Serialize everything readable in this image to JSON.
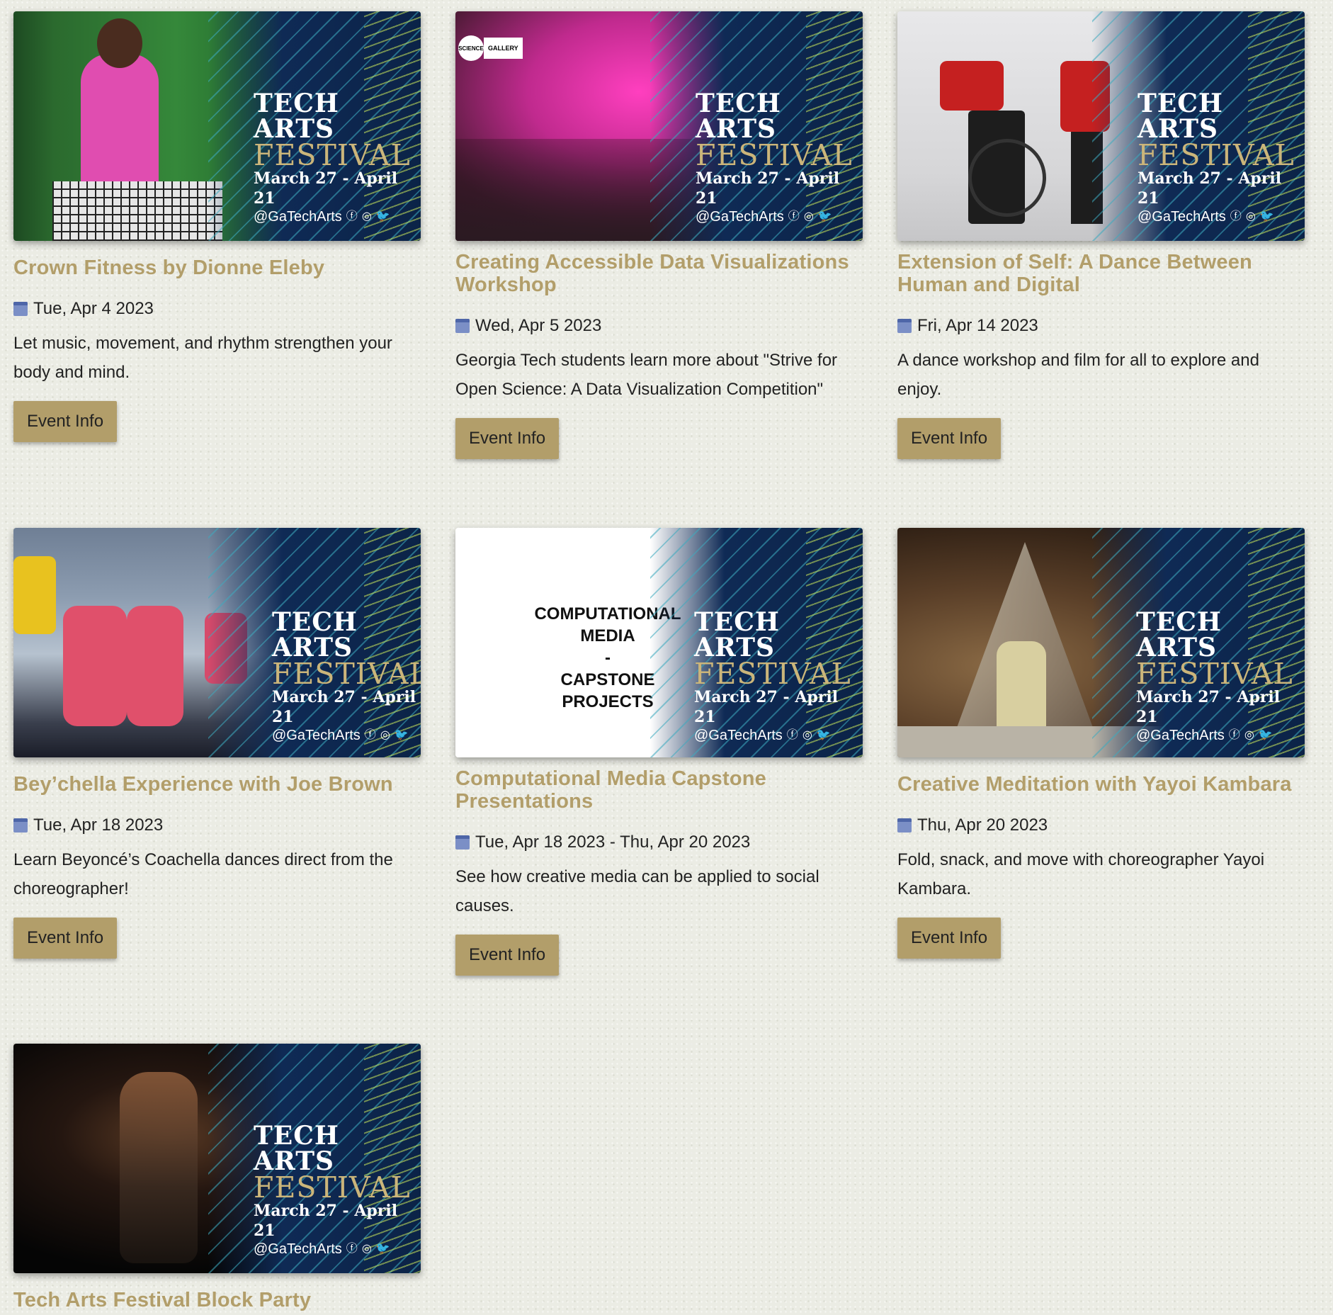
{
  "banner": {
    "line1": "TECH ARTS",
    "line2": "FESTIVAL",
    "dates": "March 27 - April 21",
    "handle": "@GaTechArts",
    "social_icons": [
      "facebook-icon",
      "instagram-icon",
      "twitter-icon"
    ]
  },
  "colors": {
    "accent": "#b29e6a",
    "banner_navy": "#0f2a55",
    "calendar": "#7b8fc6"
  },
  "events": [
    {
      "title": "Crown Fitness by Dionne Eleby",
      "date": "Tue, Apr 4 2023",
      "description": "Let music, movement, and rhythm strengthen your body and mind.",
      "button": "Event Info"
    },
    {
      "title": "Creating Accessible Data Visualizations Workshop",
      "date": "Wed, Apr 5 2023",
      "description": "Georgia Tech students learn more about \"Strive for Open Science: A Data Visualization Competition\"",
      "button": "Event Info",
      "badge_circle": "SCIENCE",
      "badge_box": "GALLERY"
    },
    {
      "title": "Extension of Self: A Dance Between Human and Digital",
      "date": "Fri, Apr 14 2023",
      "description": "A dance workshop and film for all to explore and enjoy.",
      "button": "Event Info"
    },
    {
      "title": "Bey’chella Experience with Joe Brown",
      "date": "Tue, Apr 18 2023",
      "description": "Learn Beyoncé’s Coachella dances direct from the choreographer!",
      "button": "Event Info"
    },
    {
      "title": "Computational Media Capstone Presentations",
      "date": "Tue, Apr 18 2023 - Thu, Apr 20 2023",
      "description": "See how creative media can be applied to social causes.",
      "button": "Event Info",
      "image_text": [
        "COMPUTATIONAL",
        "MEDIA",
        "-",
        "CAPSTONE",
        "PROJECTS"
      ]
    },
    {
      "title": "Creative Meditation with Yayoi Kambara",
      "date": "Thu, Apr 20 2023",
      "description": "Fold, snack, and move with choreographer Yayoi Kambara.",
      "button": "Event Info"
    },
    {
      "title": "Tech Arts Festival Block Party"
    }
  ]
}
